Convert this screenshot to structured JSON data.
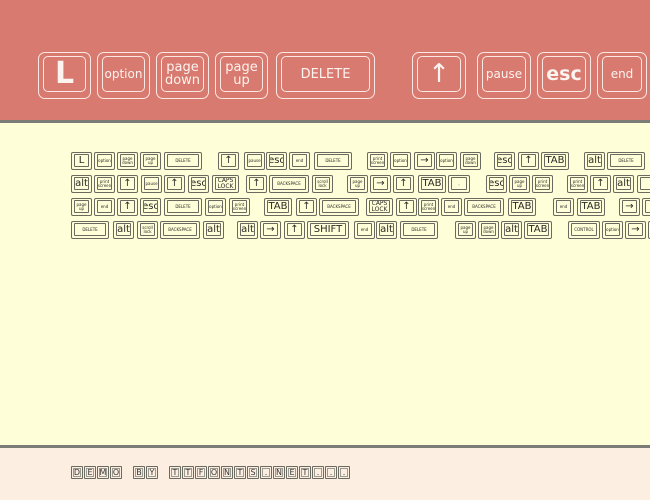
{
  "banner": {
    "keys": [
      {
        "label": "L",
        "name": "key-l"
      },
      {
        "label": "option",
        "name": "key-option"
      },
      {
        "label": "page\ndown",
        "name": "key-page-down"
      },
      {
        "label": "page\nup",
        "name": "key-page-up"
      },
      {
        "label": "DELETE",
        "name": "key-delete"
      },
      {
        "label": "↑",
        "name": "key-arrow-up"
      },
      {
        "label": "pause",
        "name": "key-pause"
      },
      {
        "label": "esc",
        "name": "key-esc"
      },
      {
        "label": "end",
        "name": "key-end"
      }
    ]
  },
  "sample": {
    "rows": [
      [
        "L",
        "option",
        "page\ndown",
        "page\nup",
        "DELETE",
        "↑",
        "pause",
        "esc",
        "end",
        "DELETE",
        "print\nscreen",
        "option",
        "→",
        "option",
        "page\ndown",
        "esc",
        "↑",
        "TAB",
        "alt",
        "DELETE"
      ],
      [
        "alt",
        "print\nscreen",
        "↑",
        "pause",
        "↑",
        "esc",
        "CAPS\nLOCK",
        "↑",
        "BACKSPACE",
        "scroll\nlock",
        "page\nup",
        "→",
        "↑",
        "TAB",
        ",",
        "esc",
        "page\nup",
        "print\nscreen",
        "print\nscreen",
        "↑",
        "alt",
        ""
      ],
      [
        "page\nup",
        "end",
        "↑",
        "esc",
        "DELETE",
        "option",
        "print\nscreen",
        "TAB",
        "↑",
        "BACKSPACE",
        "CAPS\nLOCK",
        "↑",
        "print\nscreen",
        "end",
        "BACKSPACE",
        "TAB",
        "end",
        "TAB",
        "→",
        ""
      ],
      [
        "DELETE",
        "alt",
        "scroll\nlock",
        "BACKSPACE",
        "alt",
        "alt",
        "→",
        "↑",
        "SHIFT",
        "end",
        "alt",
        "DELETE",
        "page\nup",
        "page\ndown",
        "alt",
        "TAB",
        "CONTROL",
        "option",
        "→",
        ""
      ]
    ]
  },
  "footer": {
    "demo_text": "DEMO BY TTFONTS.NET..."
  }
}
